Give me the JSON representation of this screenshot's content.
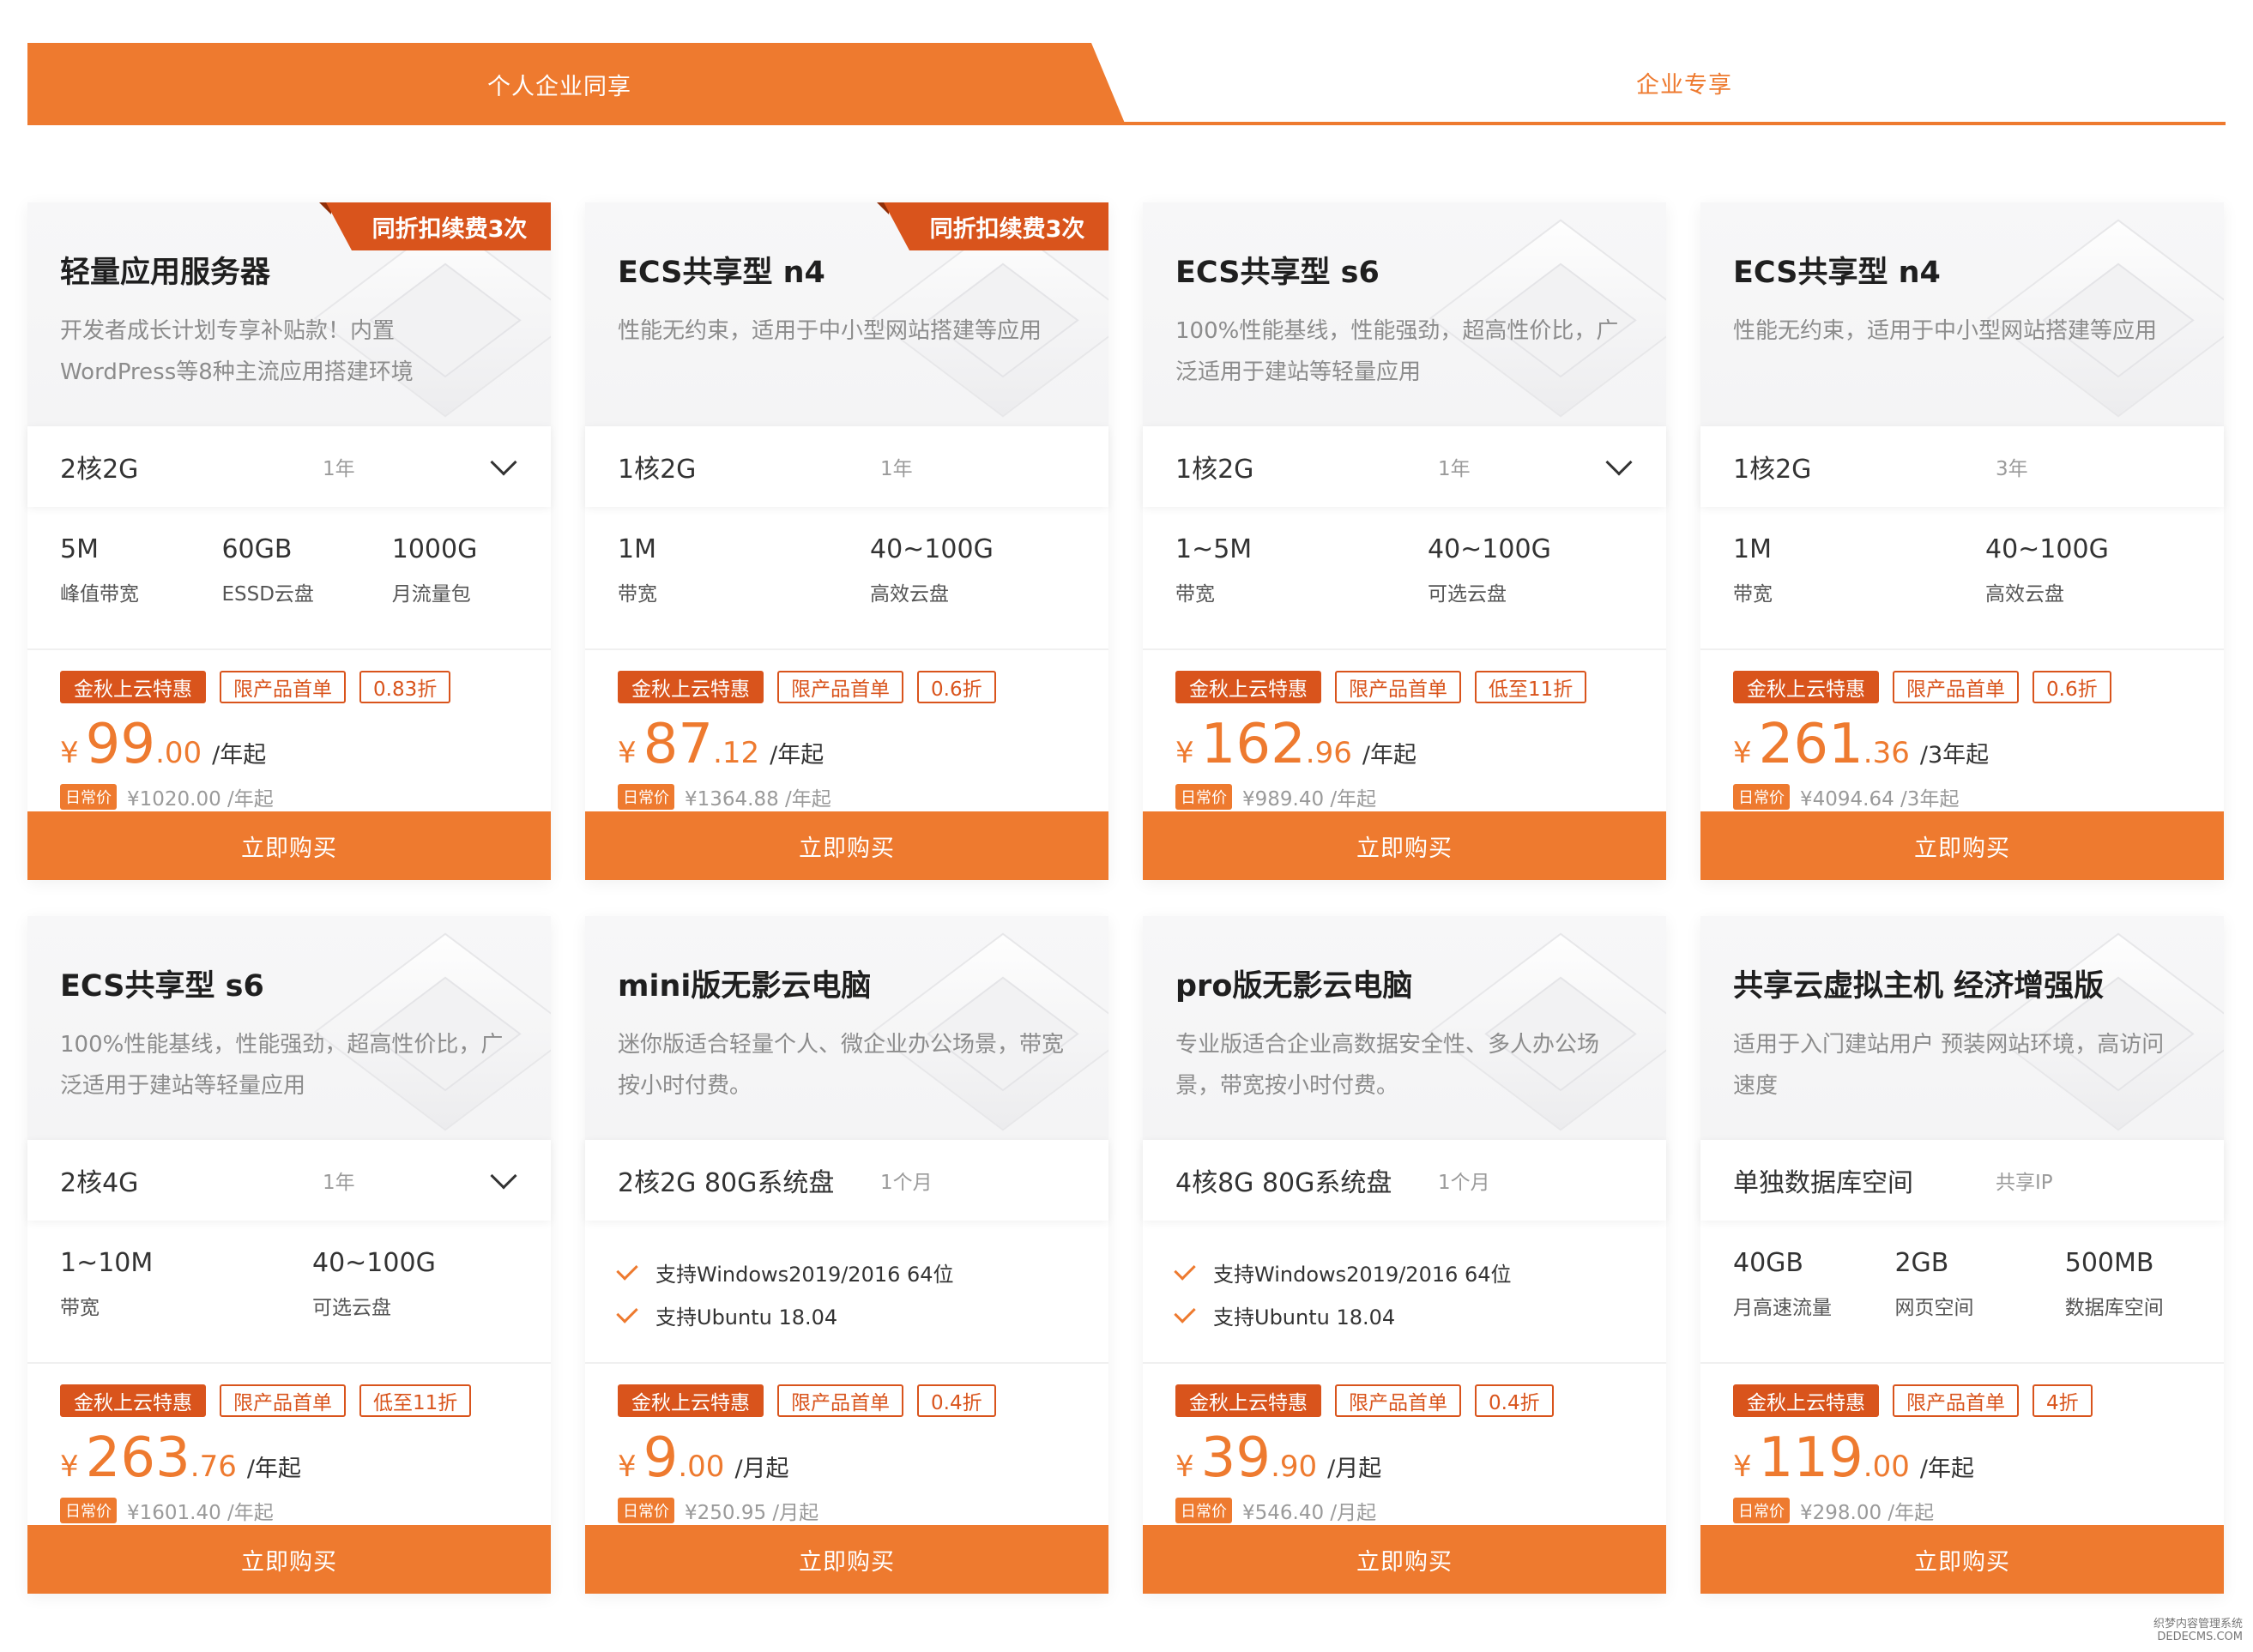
{
  "tabs": {
    "active": "个人企业同享",
    "inactive": "企业专享"
  },
  "buy_label": "立即购买",
  "orig_badge": "日常价",
  "colors": {
    "accent": "#EE7A2F",
    "accent_dark": "#D9541C"
  },
  "cards": [
    {
      "title": "轻量应用服务器",
      "desc": "开发者成长计划专享补贴款！内置WordPress等8种主流应用搭建环境",
      "ribbon": "同折扣续费3次",
      "spec_main": "2核2G",
      "spec_period": "1年",
      "has_dropdown": true,
      "specs": [
        {
          "val": "5M",
          "lab": "峰值带宽"
        },
        {
          "val": "60GB",
          "lab": "ESSD云盘"
        },
        {
          "val": "1000G",
          "lab": "月流量包"
        }
      ],
      "tags": [
        "金秋上云特惠",
        "限产品首单",
        "0.83折"
      ],
      "price_currency": "¥",
      "price_int": "99",
      "price_dec": ".00",
      "price_unit": "/年起",
      "orig_price": "¥1020.00 /年起"
    },
    {
      "title": "ECS共享型 n4",
      "desc": "性能无约束，适用于中小型网站搭建等应用",
      "ribbon": "同折扣续费3次",
      "spec_main": "1核2G",
      "spec_period": "1年",
      "has_dropdown": false,
      "specs": [
        {
          "val": "1M",
          "lab": "带宽"
        },
        {
          "val": "40~100G",
          "lab": "高效云盘"
        }
      ],
      "tags": [
        "金秋上云特惠",
        "限产品首单",
        "0.6折"
      ],
      "price_currency": "¥",
      "price_int": "87",
      "price_dec": ".12",
      "price_unit": "/年起",
      "orig_price": "¥1364.88 /年起"
    },
    {
      "title": "ECS共享型 s6",
      "desc": "100%性能基线，性能强劲，超高性价比，广泛适用于建站等轻量应用",
      "ribbon": "",
      "spec_main": "1核2G",
      "spec_period": "1年",
      "has_dropdown": true,
      "specs": [
        {
          "val": "1~5M",
          "lab": "带宽"
        },
        {
          "val": "40~100G",
          "lab": "可选云盘"
        }
      ],
      "tags": [
        "金秋上云特惠",
        "限产品首单",
        "低至11折"
      ],
      "price_currency": "¥",
      "price_int": "162",
      "price_dec": ".96",
      "price_unit": "/年起",
      "orig_price": "¥989.40 /年起"
    },
    {
      "title": "ECS共享型 n4",
      "desc": "性能无约束，适用于中小型网站搭建等应用",
      "ribbon": "",
      "spec_main": "1核2G",
      "spec_period": "3年",
      "has_dropdown": false,
      "specs": [
        {
          "val": "1M",
          "lab": "带宽"
        },
        {
          "val": "40~100G",
          "lab": "高效云盘"
        }
      ],
      "tags": [
        "金秋上云特惠",
        "限产品首单",
        "0.6折"
      ],
      "price_currency": "¥",
      "price_int": "261",
      "price_dec": ".36",
      "price_unit": "/3年起",
      "orig_price": "¥4094.64 /3年起"
    },
    {
      "title": "ECS共享型 s6",
      "desc": "100%性能基线，性能强劲，超高性价比，广泛适用于建站等轻量应用",
      "ribbon": "",
      "spec_main": "2核4G",
      "spec_period": "1年",
      "has_dropdown": true,
      "specs": [
        {
          "val": "1~10M",
          "lab": "带宽"
        },
        {
          "val": "40~100G",
          "lab": "可选云盘"
        }
      ],
      "tags": [
        "金秋上云特惠",
        "限产品首单",
        "低至11折"
      ],
      "price_currency": "¥",
      "price_int": "263",
      "price_dec": ".76",
      "price_unit": "/年起",
      "orig_price": "¥1601.40 /年起"
    },
    {
      "title": "mini版无影云电脑",
      "desc": "迷你版适合轻量个人、微企业办公场景，带宽按小时付费。",
      "ribbon": "",
      "spec_main": "2核2G 80G系统盘",
      "spec_period": "1个月",
      "has_dropdown": false,
      "checks": [
        "支持Windows2019/2016 64位",
        "支持Ubuntu 18.04"
      ],
      "tags": [
        "金秋上云特惠",
        "限产品首单",
        "0.4折"
      ],
      "price_currency": "¥",
      "price_int": "9",
      "price_dec": ".00",
      "price_unit": "/月起",
      "orig_price": "¥250.95 /月起"
    },
    {
      "title": "pro版无影云电脑",
      "desc": "专业版适合企业高数据安全性、多人办公场景，带宽按小时付费。",
      "ribbon": "",
      "spec_main": "4核8G 80G系统盘",
      "spec_period": "1个月",
      "has_dropdown": false,
      "checks": [
        "支持Windows2019/2016 64位",
        "支持Ubuntu 18.04"
      ],
      "tags": [
        "金秋上云特惠",
        "限产品首单",
        "0.4折"
      ],
      "price_currency": "¥",
      "price_int": "39",
      "price_dec": ".90",
      "price_unit": "/月起",
      "orig_price": "¥546.40 /月起"
    },
    {
      "title": "共享云虚拟主机 经济增强版",
      "desc": "适用于入门建站用户 预装网站环境，高访问速度",
      "ribbon": "",
      "spec_main": "单独数据库空间",
      "spec_period": "共享IP",
      "has_dropdown": false,
      "specs": [
        {
          "val": "40GB",
          "lab": "月高速流量"
        },
        {
          "val": "2GB",
          "lab": "网页空间"
        },
        {
          "val": "500MB",
          "lab": "数据库空间"
        }
      ],
      "tags": [
        "金秋上云特惠",
        "限产品首单",
        "4折"
      ],
      "price_currency": "¥",
      "price_int": "119",
      "price_dec": ".00",
      "price_unit": "/年起",
      "orig_price": "¥298.00 /年起"
    }
  ],
  "watermark": [
    "织梦内容管理系统",
    "DEDECMS.COM"
  ]
}
